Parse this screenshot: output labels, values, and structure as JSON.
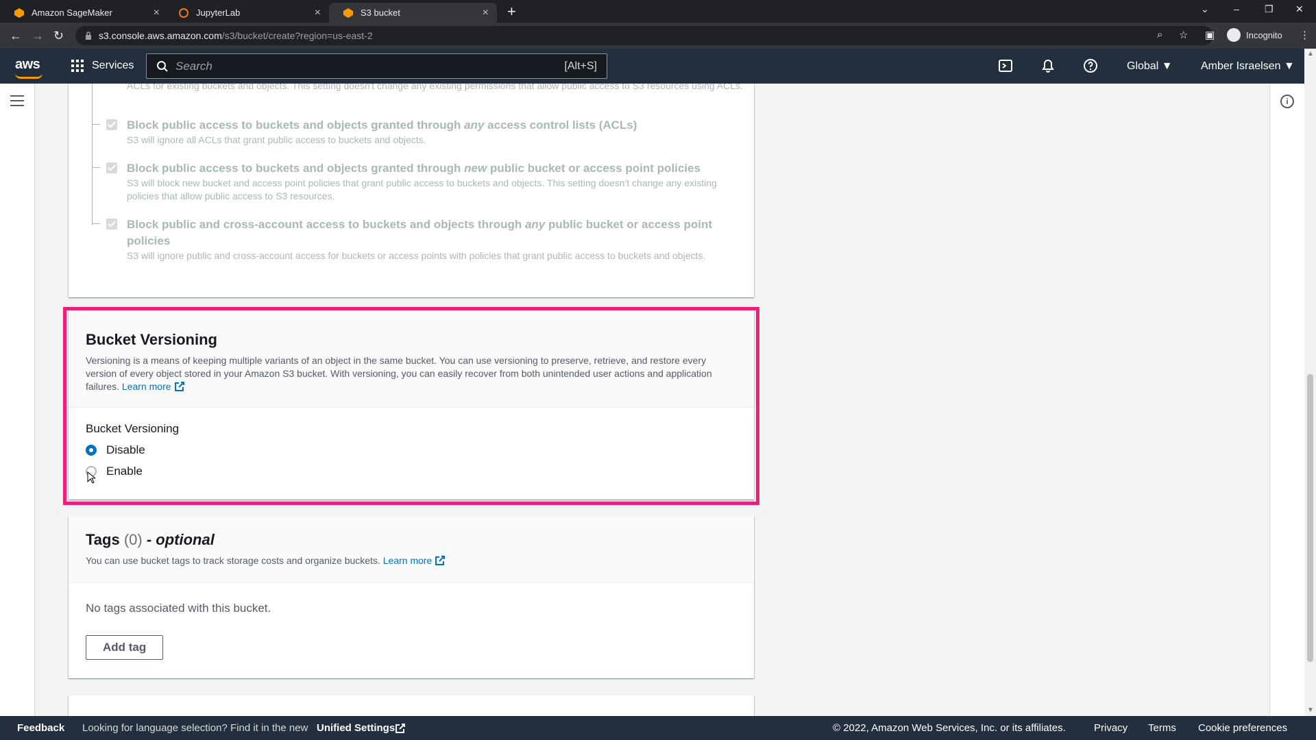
{
  "browser": {
    "tabs": [
      {
        "title": "Amazon SageMaker",
        "close": "×"
      },
      {
        "title": "JupyterLab",
        "close": "×"
      },
      {
        "title": "S3 bucket",
        "close": "×"
      }
    ],
    "new_tab": "+",
    "url_host": "s3.console.aws.amazon.com",
    "url_path": "/s3/bucket/create?region=us-east-2",
    "profile": "Incognito"
  },
  "aws_header": {
    "logo": "aws",
    "services": "Services",
    "search_placeholder": "Search",
    "search_shortcut": "[Alt+S]",
    "region": "Global ▼",
    "user": "Amber Israelsen ▼"
  },
  "block_public_access": {
    "cut_text": "ACLs for existing buckets and objects. This setting doesn't change any existing permissions that allow public access to S3 resources using ACLs.",
    "options": [
      {
        "title_pre": "Block public access to buckets and objects granted through ",
        "title_em": "any",
        "title_post": " access control lists (ACLs)",
        "desc": "S3 will ignore all ACLs that grant public access to buckets and objects."
      },
      {
        "title_pre": "Block public access to buckets and objects granted through ",
        "title_em": "new",
        "title_post": " public bucket or access point policies",
        "desc": "S3 will block new bucket and access point policies that grant public access to buckets and objects. This setting doesn't change any existing policies that allow public access to S3 resources."
      },
      {
        "title_pre": "Block public and cross-account access to buckets and objects through ",
        "title_em": "any",
        "title_post": " public bucket or access point policies",
        "desc": "S3 will ignore public and cross-account access for buckets or access points with policies that grant public access to buckets and objects."
      }
    ]
  },
  "bucket_versioning": {
    "title": "Bucket Versioning",
    "description": "Versioning is a means of keeping multiple variants of an object in the same bucket. You can use versioning to preserve, retrieve, and restore every version of every object stored in your Amazon S3 bucket. With versioning, you can easily recover from both unintended user actions and application failures.",
    "learn_more": "Learn more",
    "field_label": "Bucket Versioning",
    "options": [
      {
        "label": "Disable",
        "selected": true
      },
      {
        "label": "Enable",
        "selected": false
      }
    ]
  },
  "tags": {
    "title": "Tags",
    "count": "(0)",
    "optional": "- optional",
    "description": "You can use bucket tags to track storage costs and organize buckets.",
    "learn_more": "Learn more",
    "empty": "No tags associated with this bucket.",
    "add_button": "Add tag"
  },
  "footer": {
    "feedback": "Feedback",
    "language_prompt": "Looking for language selection? Find it in the new",
    "unified_settings": "Unified Settings",
    "copyright": "© 2022, Amazon Web Services, Inc. or its affiliates.",
    "privacy": "Privacy",
    "terms": "Terms",
    "cookie": "Cookie preferences"
  },
  "colors": {
    "aws_navy": "#232f3e",
    "aws_orange": "#ff9900",
    "link_blue": "#0073bb",
    "highlight_pink": "#ec1e79"
  }
}
